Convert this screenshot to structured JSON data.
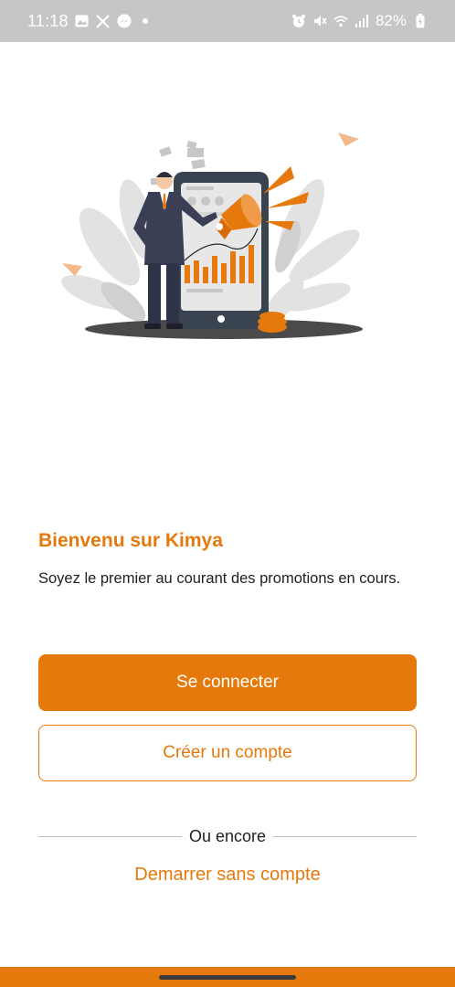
{
  "status_bar": {
    "time": "11:18",
    "battery": "82%",
    "icons_left": [
      "gallery-icon",
      "x-app-icon",
      "messenger-icon",
      "dot-icon"
    ],
    "icons_right": [
      "alarm-icon",
      "mute-icon",
      "wifi-icon",
      "signal-icon",
      "battery-icon"
    ]
  },
  "welcome": {
    "title": "Bienvenu sur Kimya",
    "subtitle": "Soyez le premier au courant des promotions en cours."
  },
  "actions": {
    "login_label": "Se connecter",
    "register_label": "Créer un compte",
    "divider_label": "Ou encore",
    "guest_label": "Demarrer sans compte"
  },
  "colors": {
    "accent": "#e5790c",
    "status_bar": "#c6c6c6",
    "text": "#1f1f1f"
  }
}
